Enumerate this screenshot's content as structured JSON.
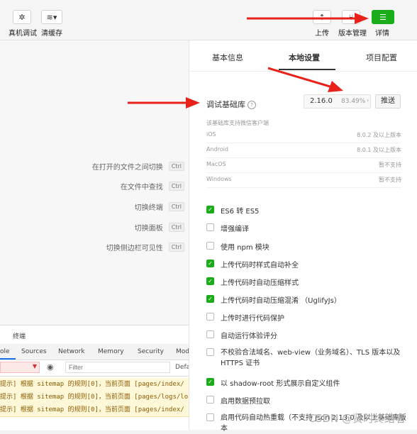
{
  "toolbar": {
    "real_debug": "真机调试",
    "clear_cache": "清缓存",
    "upload": "上传",
    "version_mgmt": "版本管理",
    "detail": "详情"
  },
  "editor": {
    "shortcuts": [
      {
        "label": "在打开的文件之间切换",
        "key": "Ctrl"
      },
      {
        "label": "在文件中查找",
        "key": "Ctrl"
      },
      {
        "label": "切换终端",
        "key": "Ctrl"
      },
      {
        "label": "切换面板",
        "key": "Ctrl"
      },
      {
        "label": "切换侧边栏可见性",
        "key": "Ctrl"
      }
    ]
  },
  "console": {
    "title": "终端",
    "tabs": [
      "ole",
      "Sources",
      "Network",
      "Memory",
      "Security",
      "Mod"
    ],
    "filter_placeholder": "Filter",
    "default_levels": "Defa",
    "logs": [
      "提示] 根据 sitemap 的规则[0]，当前页面 [pages/index/",
      "提示] 根据 sitemap 的规则[0]，当前页面 [pages/logs/lo",
      "提示] 根据 sitemap 的规则[0]，当前页面 [pages/index/"
    ]
  },
  "panel": {
    "tabs": [
      "基本信息",
      "本地设置",
      "项目配置"
    ],
    "active_tab": "本地设置",
    "lib_label": "调试基础库",
    "lib_version": "2.16.0",
    "lib_coverage": "83.49%",
    "push_label": "推送",
    "support_title": "该基础库支持微信客户端",
    "support": [
      {
        "os": "iOS",
        "version": "8.0.2 及以上版本"
      },
      {
        "os": "Android",
        "version": "8.0.1 及以上版本"
      },
      {
        "os": "MacOS",
        "version": "暂不支持"
      },
      {
        "os": "Windows",
        "version": "暂不支持"
      }
    ],
    "options": [
      {
        "label": "ES6 转 ES5",
        "checked": true
      },
      {
        "label": "增强编译",
        "checked": false
      },
      {
        "label": "使用 npm 模块",
        "checked": false
      },
      {
        "label": "上传代码时样式自动补全",
        "checked": true
      },
      {
        "label": "上传代码时自动压缩样式",
        "checked": true
      },
      {
        "label": "上传代码时自动压缩混淆 （UglifyJs）",
        "checked": true
      },
      {
        "label": "上传时进行代码保护",
        "checked": false
      },
      {
        "label": "自动运行体验评分",
        "checked": false
      },
      {
        "label": "不校验合法域名、web-view（业务域名）、TLS 版本以及 HTTPS 证书",
        "checked": false
      },
      {
        "label": "以 shadow-root 形式展示自定义组件",
        "checked": true
      },
      {
        "label": "启用数据预拉取",
        "checked": false
      },
      {
        "label": "启用代码自动热重载（不支持 json 2.13.0 及以上基础库版本",
        "checked": false
      }
    ]
  },
  "watermark": "CSDN @贤时终结者",
  "colors": {
    "accent": "#1aad19",
    "arrow": "#e8221b"
  }
}
